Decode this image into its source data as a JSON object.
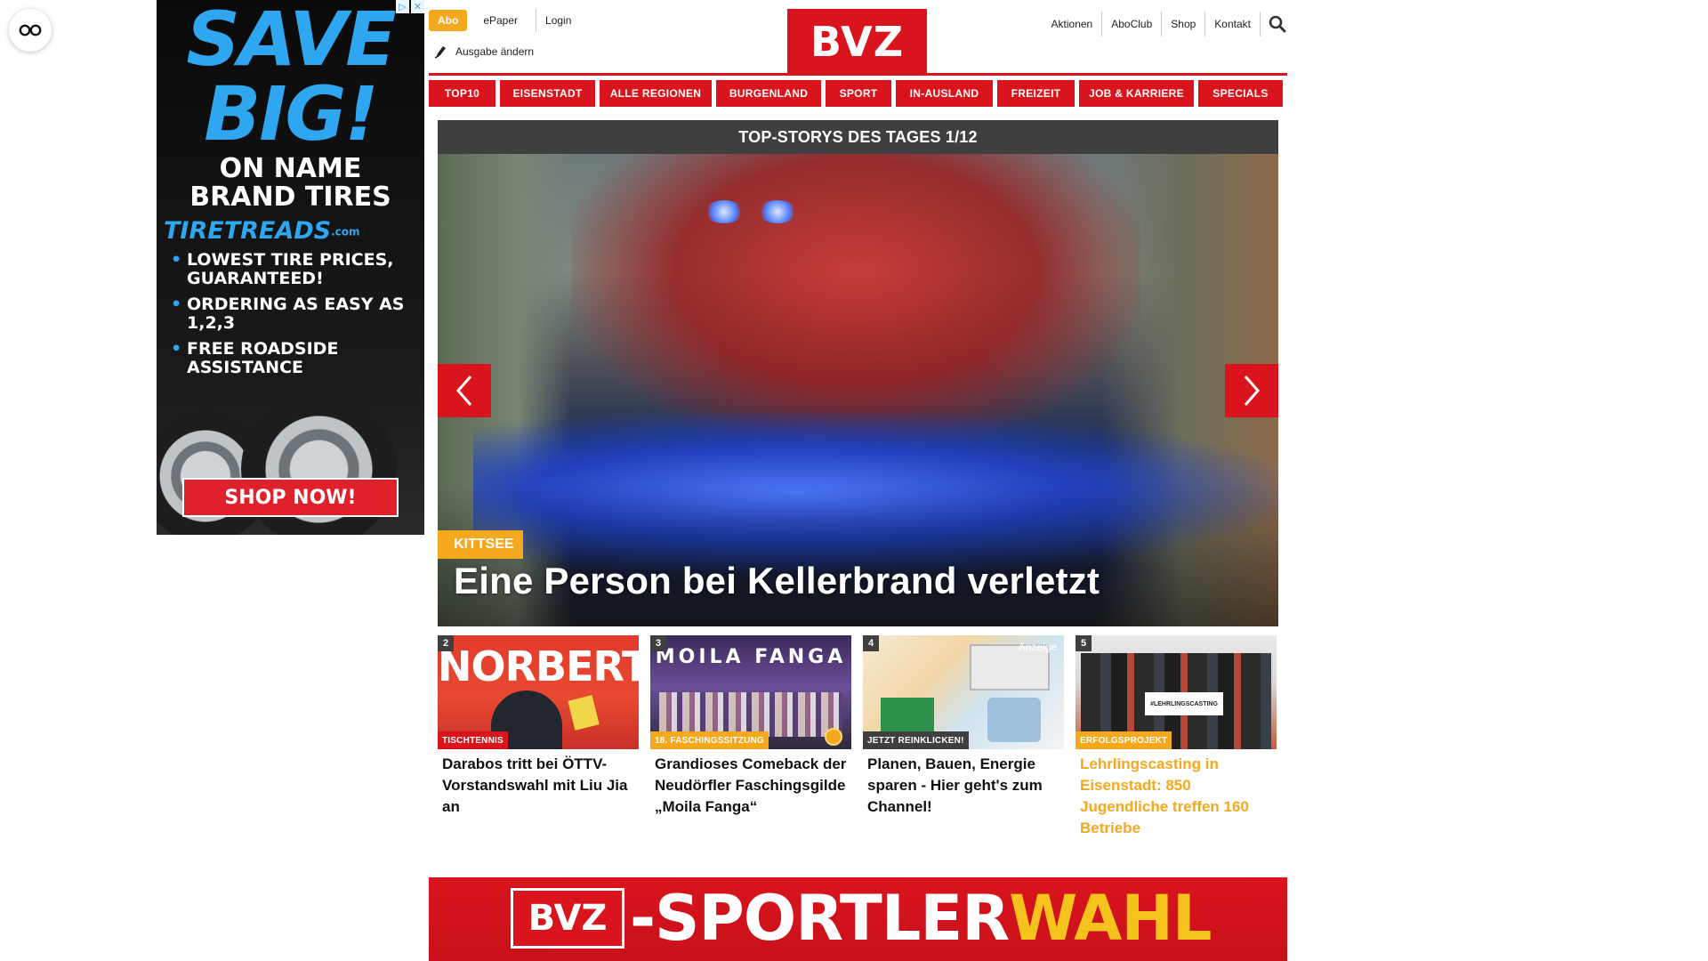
{
  "ad": {
    "save_line": "SAVE BIG!",
    "brand_line": "ON NAME BRAND TIRES",
    "logo_text": "TIRETREADS",
    "logo_suffix": ".com",
    "bullets": [
      "LOWEST TIRE PRICES, GUARANTEED!",
      "ORDERING AS EASY AS 1,2,3",
      "FREE ROADSIDE ASSISTANCE"
    ],
    "shop_label": "SHOP NOW!"
  },
  "header": {
    "abo_label": "Abo",
    "left_links": [
      "ePaper",
      "Login"
    ],
    "edition_label": "Ausgabe ändern",
    "logo_text": "BVZ",
    "right_links": [
      "Aktionen",
      "AboClub",
      "Shop",
      "Kontakt"
    ]
  },
  "nav": {
    "items": [
      "TOP10",
      "EISENSTADT",
      "ALLE REGIONEN",
      "BURGENLAND",
      "SPORT",
      "IN-AUSLAND",
      "FREIZEIT",
      "JOB & KARRIERE",
      "SPECIALS"
    ]
  },
  "slider": {
    "heading": "TOP-STORYS DES TAGES 1/12",
    "hero": {
      "kicker": "KITTSEE",
      "title": "Eine Person bei Kellerbrand verletzt"
    }
  },
  "teasers": [
    {
      "num": "2",
      "kicker": "TISCHTENNIS",
      "title": "Darabos tritt bei ÖTTV-Vorstandswahl mit Liu Jia an",
      "img_text": "NORBERT"
    },
    {
      "num": "3",
      "kicker": "18. FASCHINGSSITZUNG",
      "title": "Grandioses Comeback der Neudörfler Faschingsgilde „Moila Fanga“",
      "img_text": "MOILA FANGA"
    },
    {
      "num": "4",
      "kicker": "JETZT REINKLICKEN!",
      "title": "Planen, Bauen, Energie sparen - Hier geht's zum Channel!",
      "ad_label": "Anzeige"
    },
    {
      "num": "5",
      "kicker": "ERFOLGSPROJEKT",
      "title": "Lehrlingscasting in Eisenstadt: 850 Jugendliche treffen 160 Betriebe",
      "sign_text": "#LEHRLINGSCASTING"
    }
  ],
  "banner": {
    "logo_text": "BVZ",
    "text_part1": "-SPORTLER",
    "text_part2": "WAHL"
  },
  "colors": {
    "brand_red": "#d9141c",
    "accent_yellow": "#f4a81d",
    "slider_head": "#3f3f3f"
  }
}
